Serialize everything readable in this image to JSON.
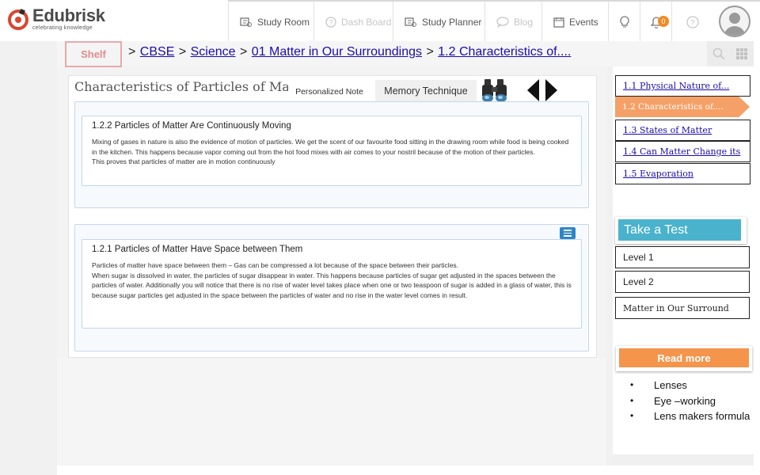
{
  "brand": {
    "name": "Edubrisk",
    "tagline": "celebrating knowledge"
  },
  "nav": {
    "items": [
      {
        "label": "Study Room",
        "icon": "study-room-icon"
      },
      {
        "label": "Dash Board",
        "icon": "dashboard-icon"
      },
      {
        "label": "Study Planner",
        "icon": "planner-icon"
      },
      {
        "label": "Blog",
        "icon": "chat-bubble-icon"
      },
      {
        "label": "Events",
        "icon": "calendar-icon"
      }
    ],
    "notification_count": "0"
  },
  "shelf_label": "Shelf",
  "breadcrumb": [
    {
      "label": "CBSE"
    },
    {
      "label": "Science"
    },
    {
      "label": "01 Matter in Our Surroundings"
    },
    {
      "label": "1.2 Characteristics of...."
    }
  ],
  "breadcrumb_sep": ">",
  "page_title": "Characteristics of Particles of Matter",
  "tabs": {
    "personalized_note": "Personalized Note",
    "memory_technique": "Memory Technique"
  },
  "cards": [
    {
      "title": "1.2.2 Particles of Matter Are Continuously Moving",
      "paragraphs": [
        "Mixing of gases in nature is also the evidence of motion of particles. We get the scent of our favourite food sitting in the drawing room while food is being cooked in the kitchen. This happens because vapor coming out from the hot food mixes with air comes to your nostril because of the motion of their particles.",
        "This proves that particles of matter are in motion continuously"
      ]
    },
    {
      "title": "1.2.1 Particles of Matter Have Space between Them",
      "paragraphs": [
        "Particles of matter have space between them – Gas can be compressed a lot because of the space between their particles.",
        "When sugar is dissolved in water, the particles of sugar disappear in water. This happens because particles of sugar get adjusted in the spaces between the particles of water. Additionally you will notice that there is no rise of water level takes place when one or two teaspoon of sugar is added in a glass of water, this is because sugar particles get adjusted in the space between the particles of water and no rise in the water level comes in result."
      ]
    }
  ],
  "sidebar": {
    "topics": [
      {
        "label": "1.1 Physical Nature of..."
      },
      {
        "label": "1.2 Characteristics of...."
      },
      {
        "label": "1.3 States of Matter"
      },
      {
        "label": "1.4 Can Matter Change its"
      },
      {
        "label": "1.5 Evaporation"
      }
    ],
    "take_test": "Take a Test",
    "levels": [
      "Level 1",
      "Level 2",
      "Matter in Our Surround"
    ],
    "read_more": "Read more",
    "bullets": [
      "Lenses",
      "Eye –working",
      "Lens makers formula"
    ]
  },
  "colors": {
    "accent_orange": "#f5954b",
    "test_blue": "#4ab2cc",
    "active_topic": "#f5a066"
  }
}
